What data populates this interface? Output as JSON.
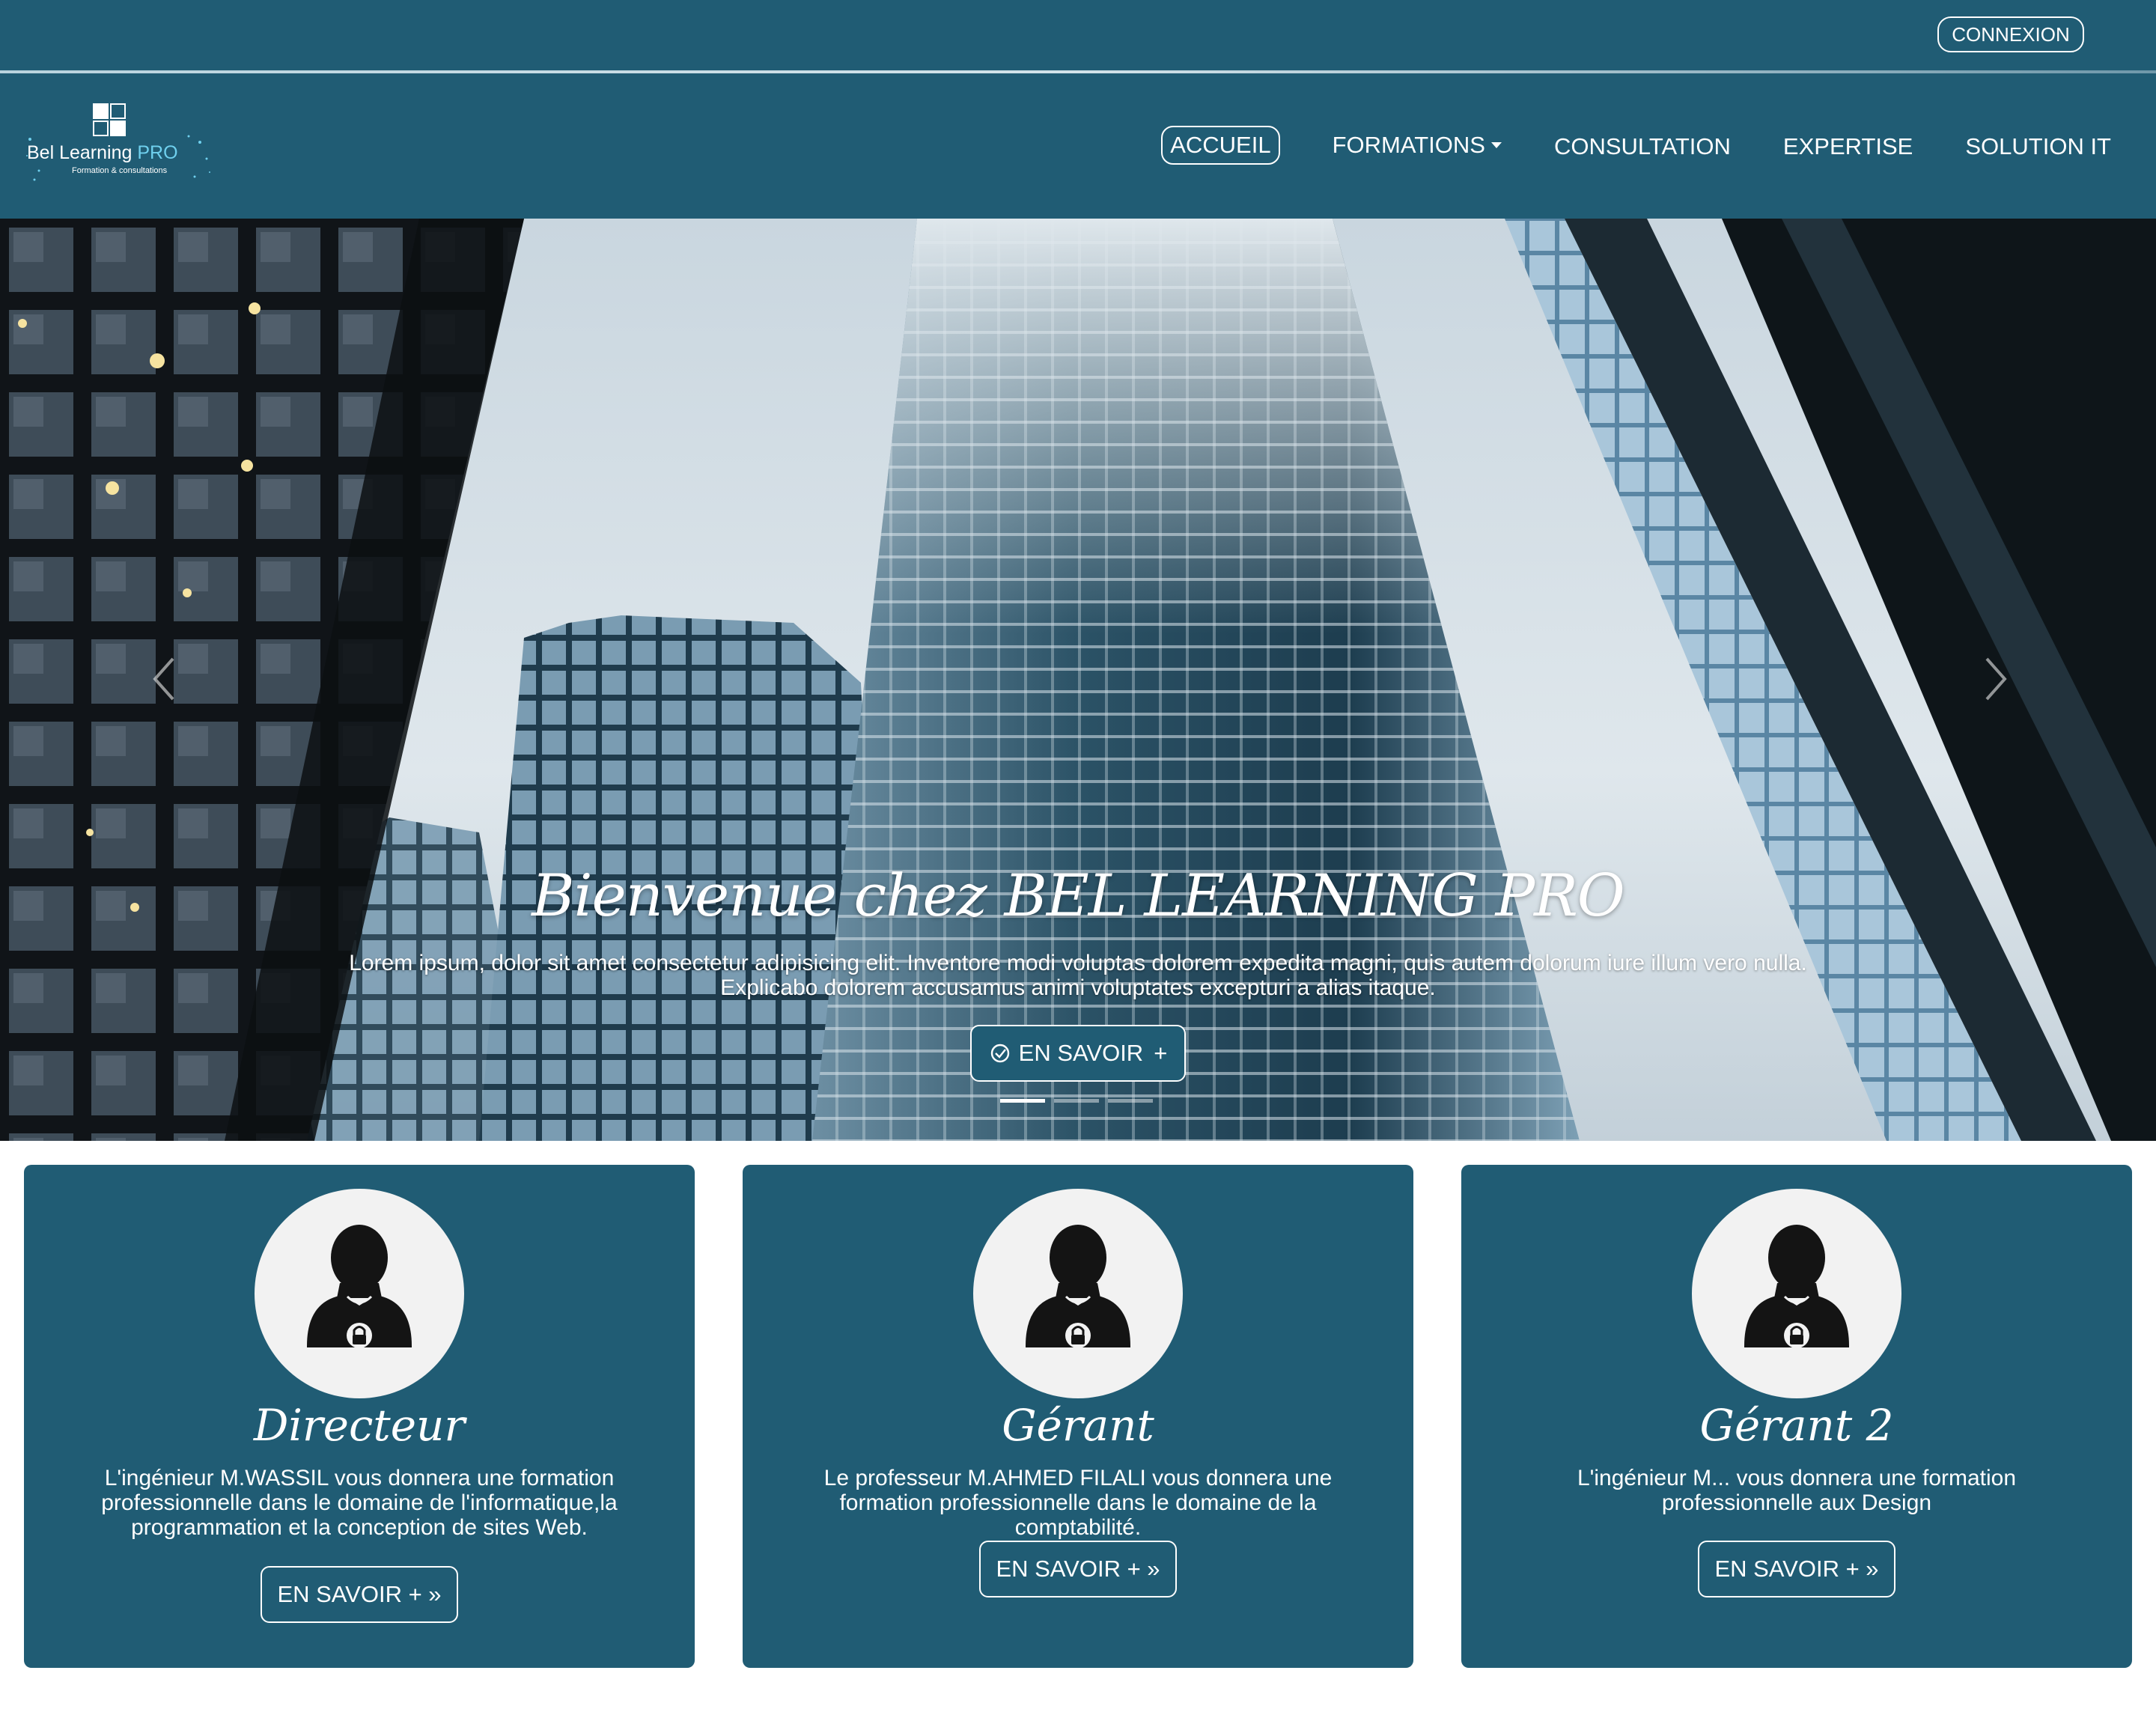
{
  "topbar": {
    "login_label": "CONNEXION"
  },
  "logo": {
    "name_part1": "Bel Learning",
    "name_part2": "PRO",
    "tagline": "Formation & consultations"
  },
  "nav": {
    "items": [
      {
        "label": "ACCUEIL",
        "active": true
      },
      {
        "label": "FORMATIONS",
        "dropdown": true
      },
      {
        "label": "CONSULTATION"
      },
      {
        "label": "EXPERTISE"
      },
      {
        "label": "SOLUTION IT"
      }
    ]
  },
  "hero": {
    "title": "Bienvenue chez BEL LEARNING PRO",
    "text": "Lorem ipsum, dolor sit amet consectetur adipisicing elit. Inventore modi voluptas dolorem expedita magni, quis autem dolorum iure illum vero nulla. Explicabo dolorem accusamus animi voluptates excepturi a alias itaque.",
    "button_label": "EN SAVOIR",
    "button_plus": "+",
    "slide_count": 3,
    "active_slide": 1
  },
  "cards": [
    {
      "title": "Directeur",
      "description": "L'ingénieur M.WASSIL vous donnera une formation professionnelle dans le domaine de l'informatique,la programmation et la conception de sites Web.",
      "button_label": "EN SAVOIR + »"
    },
    {
      "title": "Gérant",
      "description": "Le professeur M.AHMED FILALI vous donnera une formation professionnelle dans le domaine de la comptabilité.",
      "button_label": "EN SAVOIR + »"
    },
    {
      "title": "Gérant 2",
      "description": "L'ingénieur M... vous donnera une formation professionnelle aux Design",
      "button_label": "EN SAVOIR + »"
    }
  ],
  "colors": {
    "primary": "#205c74",
    "white": "#ffffff",
    "avatar_bg": "#f2f2f2"
  }
}
